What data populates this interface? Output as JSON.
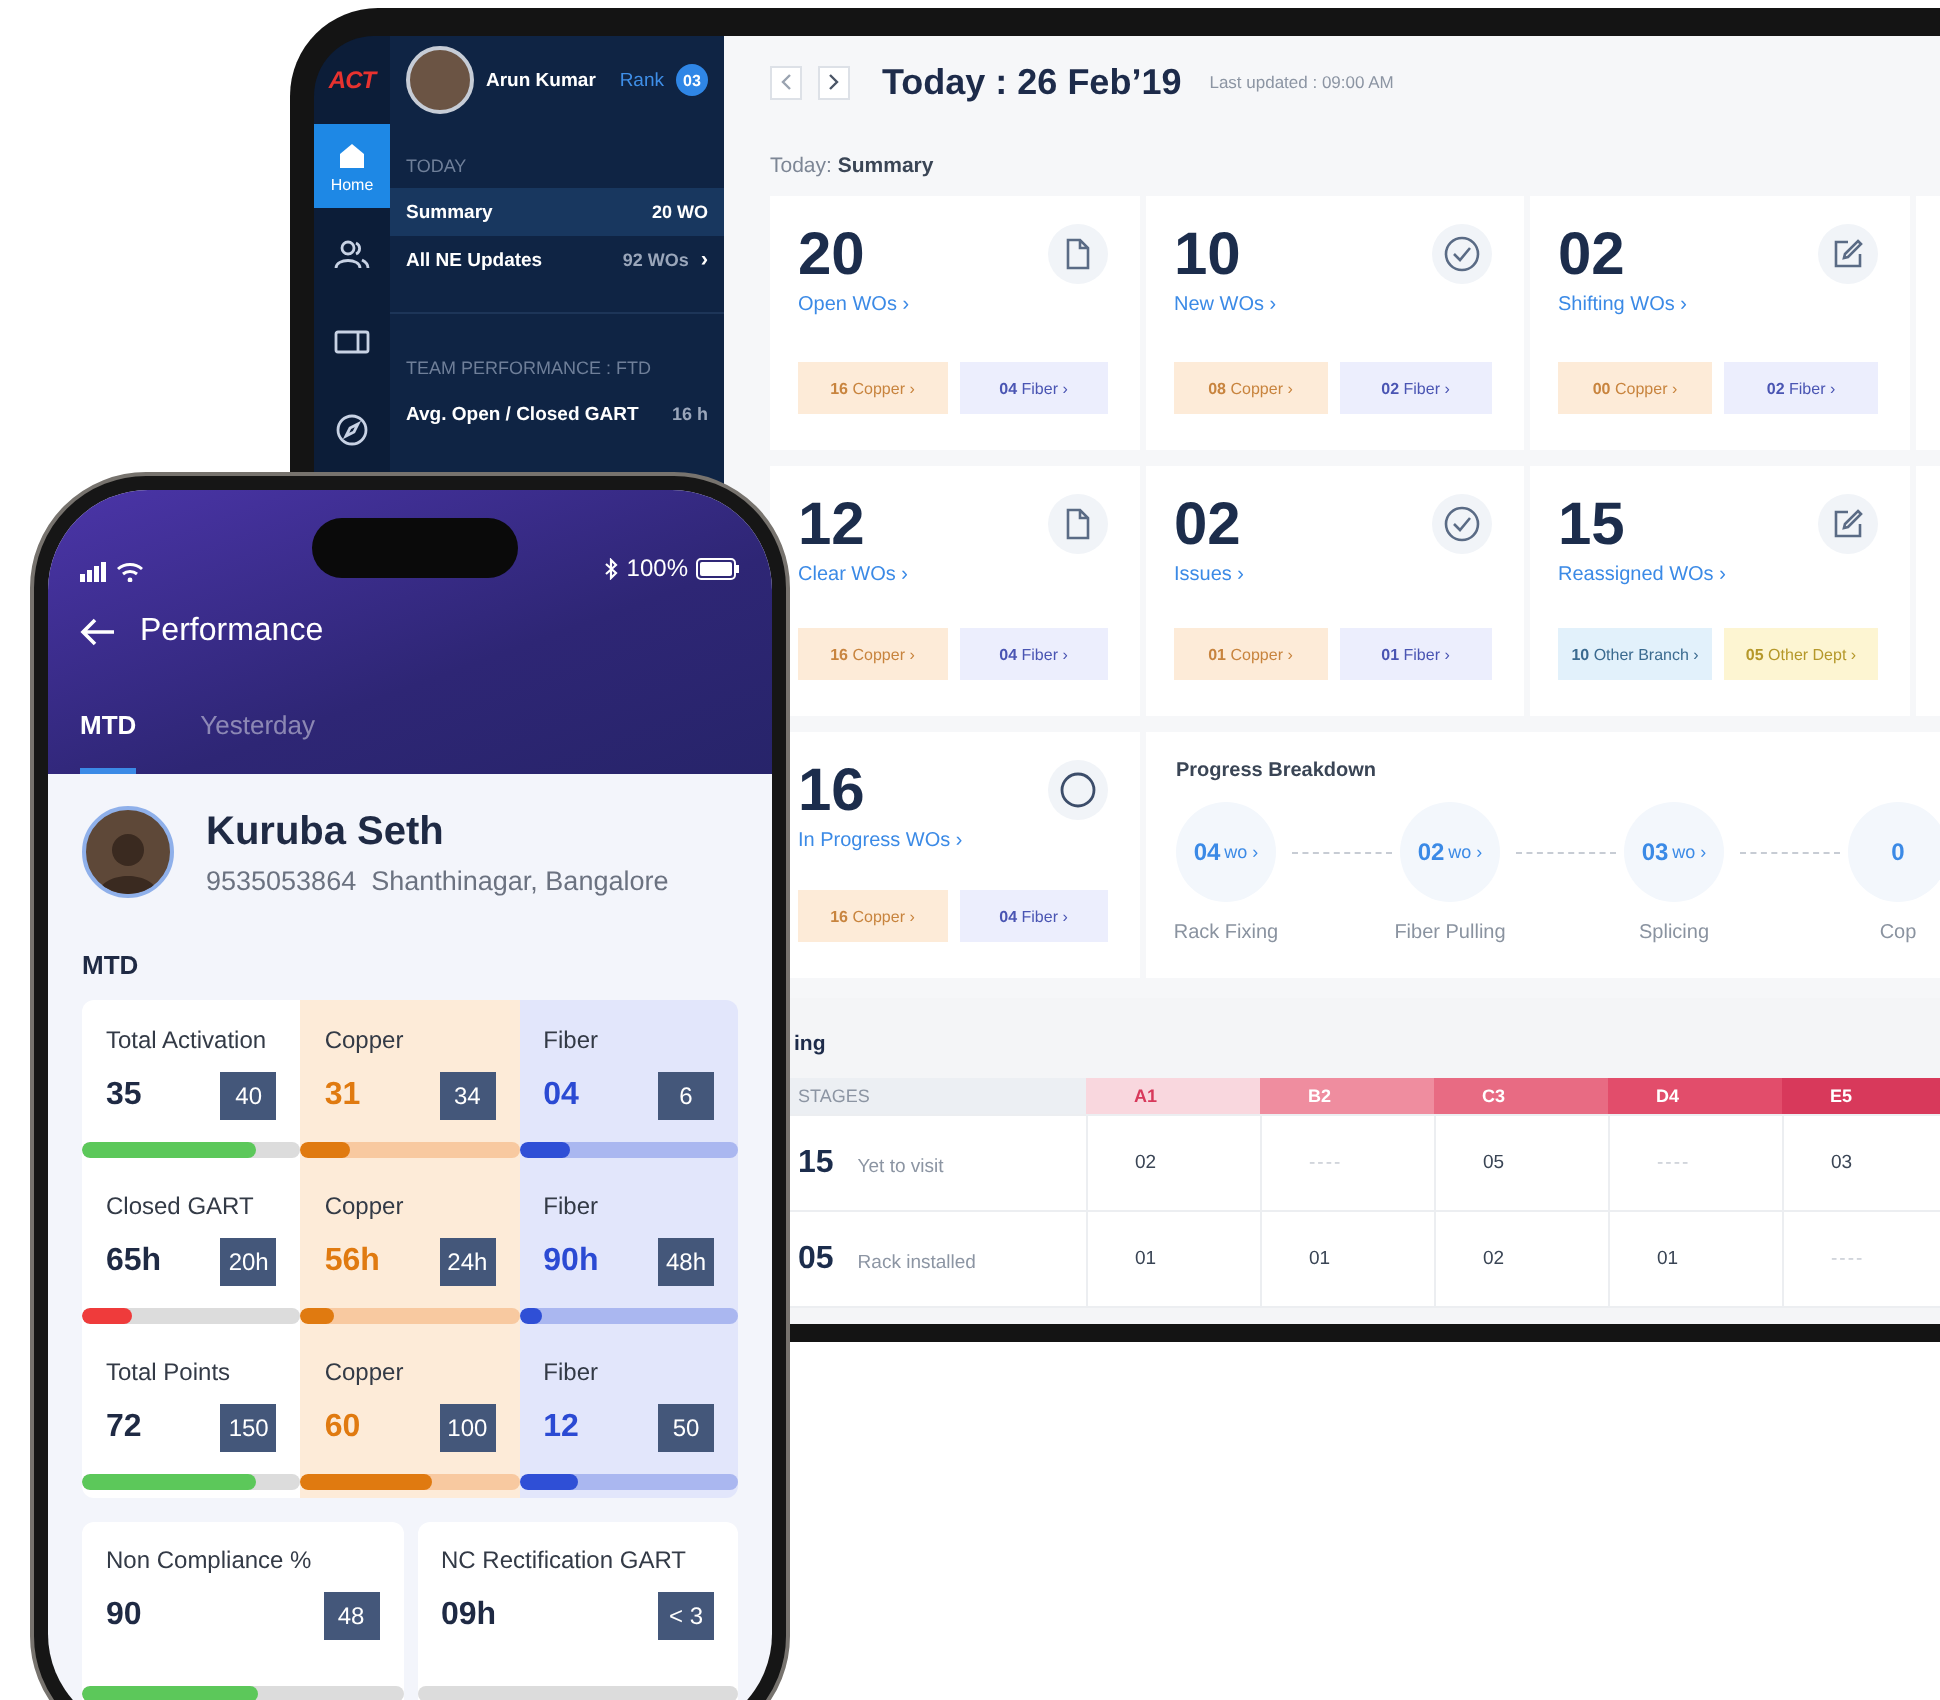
{
  "tablet": {
    "logo": "ACT",
    "rail": [
      {
        "kind": "home",
        "label": "Home",
        "selected": true
      },
      {
        "kind": "people",
        "selected": false
      },
      {
        "kind": "ticket",
        "selected": false
      },
      {
        "kind": "compass",
        "selected": false
      }
    ],
    "profile": {
      "name": "Arun Kumar",
      "rank_label": "Rank",
      "rank": "03"
    },
    "sections": [
      {
        "title": "TODAY",
        "items": [
          {
            "label": "Summary",
            "count": "20 WO",
            "selected": true
          },
          {
            "label": "All NE Updates",
            "count": "92 WOs",
            "arrow": "›",
            "selected": false
          }
        ]
      },
      {
        "title": "TEAM PERFORMANCE : FTD",
        "items": [
          {
            "label": "Avg. Open / Closed GART",
            "count": "16 h",
            "selected": false
          }
        ]
      }
    ],
    "title": "Today : 26 Feb’19",
    "last_updated": "Last updated : 09:00 AM",
    "summary_heading": "Today: **Summary**",
    "cards": [
      {
        "count": "20",
        "link": "Open WOs ›",
        "kind": "document",
        "chips": [
          {
            "kind": "copper",
            "text": "**16** Copper ›"
          },
          {
            "kind": "fiber",
            "text": "**04** Fiber ›"
          }
        ]
      },
      {
        "count": "10",
        "link": "New WOs ›",
        "kind": "check",
        "chips": [
          {
            "kind": "copper",
            "text": "**08** Copper ›"
          },
          {
            "kind": "fiber",
            "text": "**02** Fiber ›"
          }
        ]
      },
      {
        "count": "02",
        "link": "Shifting WOs ›",
        "kind": "edit",
        "chips": [
          {
            "kind": "copper",
            "text": "**00** Copper ›"
          },
          {
            "kind": "fiber",
            "text": "**02** Fiber ›"
          }
        ]
      },
      {
        "count": "12",
        "link": "Clear WOs ›",
        "kind": "document",
        "chips": [
          {
            "kind": "copper",
            "text": "**16** Copper ›"
          },
          {
            "kind": "fiber",
            "text": "**04** Fiber ›"
          }
        ]
      },
      {
        "count": "02",
        "link": "Issues ›",
        "kind": "check",
        "chips": [
          {
            "kind": "copper",
            "text": "**01** Copper ›"
          },
          {
            "kind": "fiber",
            "text": "**01** Fiber ›"
          }
        ]
      },
      {
        "count": "15",
        "link": "Reassigned WOs ›",
        "kind": "edit",
        "chips": [
          {
            "kind": "branch",
            "text": "**10** Other Branch ›"
          },
          {
            "kind": "dept",
            "text": "**05** Other Dept ›"
          }
        ]
      },
      {
        "count": "16",
        "link": "In Progress WOs ›",
        "kind": "circle",
        "chips": [
          {
            "kind": "copper",
            "text": "**16** Copper ›"
          },
          {
            "kind": "fiber",
            "text": "**04** Fiber ›"
          }
        ]
      }
    ],
    "progress": {
      "title": "Progress Breakdown",
      "steps": [
        {
          "value": "04",
          "unit": "wo ›",
          "label": "Rack Fixing"
        },
        {
          "value": "02",
          "unit": "wo ›",
          "label": "Fiber Pulling"
        },
        {
          "value": "03",
          "unit": "wo ›",
          "label": "Splicing"
        },
        {
          "value": "0",
          "label": "Cop"
        }
      ]
    },
    "table": {
      "heading": "ing",
      "stage_header": "STAGES",
      "columns": [
        {
          "label": "A1",
          "color": "#f9d7de"
        },
        {
          "label": "B2",
          "color": "#ef8d9f"
        },
        {
          "label": "C3",
          "color": "#e86b83"
        },
        {
          "label": "D4",
          "color": "#e24d6b"
        },
        {
          "label": "E5",
          "color": "#d8395b"
        }
      ],
      "rows": [
        {
          "count": "15",
          "stage": "Yet to visit",
          "cells": [
            "02",
            "----",
            "05",
            "----",
            "03"
          ]
        },
        {
          "count": "05",
          "stage": "Rack installed",
          "cells": [
            "01",
            "01",
            "02",
            "01",
            "----"
          ]
        }
      ]
    }
  },
  "phone": {
    "battery": "100%",
    "title": "Performance",
    "tabs": [
      {
        "label": "MTD",
        "selected": true
      },
      {
        "label": "Yesterday",
        "selected": false
      }
    ],
    "profile": {
      "name": "Kuruba Seth",
      "phone": "9535053864",
      "location": "Shanthinagar, Bangalore"
    },
    "section_title": "MTD",
    "metrics": [
      {
        "cells": [
          {
            "kind": "total",
            "label": "Total Activation",
            "value": "35",
            "target": "40",
            "level": 0.8,
            "color": "#5cc85a"
          },
          {
            "kind": "copper",
            "label": "Copper",
            "value": "31",
            "target": "34",
            "level": 0.23
          },
          {
            "kind": "fiber",
            "label": "Fiber",
            "value": "04",
            "target": "6",
            "level": 0.23
          }
        ]
      },
      {
        "cells": [
          {
            "kind": "total",
            "label": "Closed GART",
            "value": "65h",
            "target": "20h",
            "level": 0.23,
            "color": "#ef3b3b"
          },
          {
            "kind": "copper",
            "label": "Copper",
            "value": "56h",
            "target": "24h",
            "level": 0.15
          },
          {
            "kind": "fiber",
            "label": "Fiber",
            "value": "90h",
            "target": "48h",
            "level": 0.1
          }
        ]
      },
      {
        "cells": [
          {
            "kind": "total",
            "label": "Total Points",
            "value": "72",
            "target": "150",
            "level": 0.8,
            "color": "#5cc85a"
          },
          {
            "kind": "copper",
            "label": "Copper",
            "value": "60",
            "target": "100",
            "level": 0.6
          },
          {
            "kind": "fiber",
            "label": "Fiber",
            "value": "12",
            "target": "50",
            "level": 0.27
          }
        ]
      }
    ],
    "bottom_metrics": [
      {
        "label": "Non Compliance %",
        "value": "90",
        "target": "48",
        "level": 0.55
      },
      {
        "label": "NC Rectification GART",
        "value": "09h",
        "target": "< 3"
      }
    ]
  }
}
